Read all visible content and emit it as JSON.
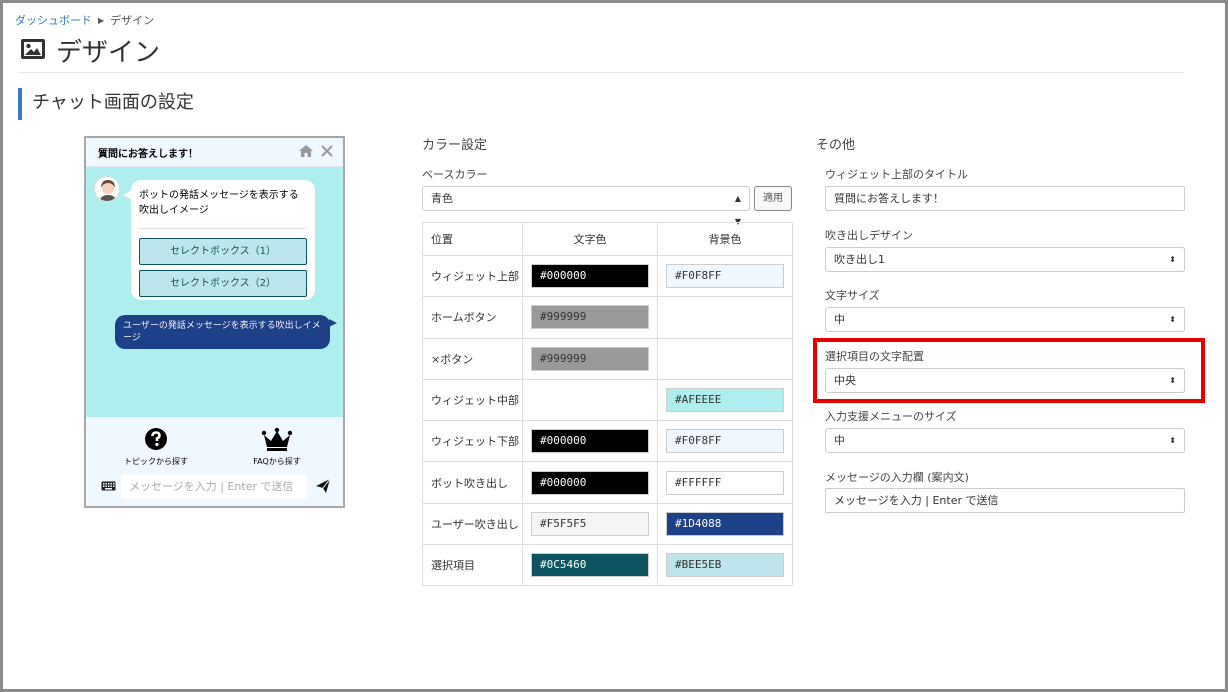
{
  "breadcrumb": {
    "home": "ダッシュボード",
    "current": "デザイン"
  },
  "page": {
    "title": "デザイン",
    "section": "チャット画面の設定"
  },
  "chat_preview": {
    "header_title": "質問にお答えします！",
    "bot_message": "ボットの発話メッセージを表示する吹出しイメージ",
    "options": [
      "セレクトボックス（1）",
      "セレクトボックス（2）"
    ],
    "user_message": "ユーザーの発話メッセージを表示する吹出しイメージ",
    "footer_topic": "トピックから探す",
    "footer_faq": "FAQから探す",
    "input_placeholder": "メッセージを入力 | Enter で送信"
  },
  "color_settings": {
    "title": "カラー設定",
    "base_color_label": "ベースカラー",
    "base_color_value": "青色",
    "apply_label": "適用",
    "headers": {
      "position": "位置",
      "text": "文字色",
      "bg": "背景色"
    },
    "rows": [
      {
        "position": "ウィジェット上部",
        "text": "#000000",
        "bg": "#F0F8FF"
      },
      {
        "position": "ホームボタン",
        "text": "#999999",
        "bg": ""
      },
      {
        "position": "×ボタン",
        "text": "#999999",
        "bg": ""
      },
      {
        "position": "ウィジェット中部",
        "text": "",
        "bg": "#AFEEEE"
      },
      {
        "position": "ウィジェット下部",
        "text": "#000000",
        "bg": "#F0F8FF"
      },
      {
        "position": "ボット吹き出し",
        "text": "#000000",
        "bg": "#FFFFFF"
      },
      {
        "position": "ユーザー吹き出し",
        "text": "#F5F5F5",
        "bg": "#1D4088"
      },
      {
        "position": "選択項目",
        "text": "#0C5460",
        "bg": "#BEE5EB"
      }
    ]
  },
  "other_settings": {
    "title": "その他",
    "widget_title_label": "ウィジェット上部のタイトル",
    "widget_title_value": "質問にお答えします！",
    "bubble_design_label": "吹き出しデザイン",
    "bubble_design_value": "吹き出し1",
    "font_size_label": "文字サイズ",
    "font_size_value": "中",
    "option_align_label": "選択項目の文字配置",
    "option_align_value": "中央",
    "input_menu_size_label": "入力支援メニューのサイズ",
    "input_menu_size_value": "中",
    "placeholder_label": "メッセージの入力欄 (案内文)",
    "placeholder_value": "メッセージを入力 | Enter で送信"
  },
  "colors": {
    "accent": "#3a7bbf",
    "highlight": "#e60000"
  }
}
